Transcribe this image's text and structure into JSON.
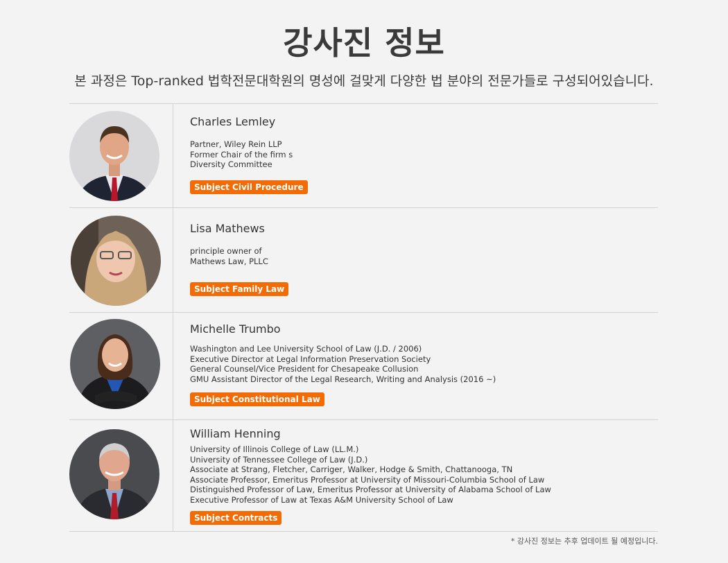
{
  "page": {
    "title": "강사진 정보",
    "subtitle": "본 과정은 Top-ranked 법학전문대학원의 명성에 걸맞게 다양한 법 분야의 전문가들로 구성되어있습니다.",
    "footnote": "* 강사진 정보는 추후 업데이트 될 예정입니다."
  },
  "accent_color": "#f26b05",
  "instructors": [
    {
      "name": "Charles Lemley",
      "lines": [
        "Partner, Wiley Rein LLP",
        "Former Chair of the firm s",
        "Diversity Committee"
      ],
      "subject": "Subject Civil Procedure"
    },
    {
      "name": "Lisa Mathews",
      "lines": [
        "principle owner of",
        "Mathews Law, PLLC"
      ],
      "subject": "Subject Family Law"
    },
    {
      "name": "Michelle Trumbo",
      "lines": [
        "Washington and Lee University School of Law (J.D. / 2006)",
        "Executive Director at Legal Information Preservation Society",
        "General Counsel/Vice President for Chesapeake Collusion",
        "GMU Assistant Director of the Legal Research, Writing and Analysis (2016 ~)"
      ],
      "subject": "Subject Constitutional Law"
    },
    {
      "name": "William Henning",
      "lines": [
        "University of Illinois College of Law (LL.M.)",
        "University of Tennessee College of Law (J.D.)",
        "Associate at Strang, Fletcher, Carriger, Walker, Hodge & Smith, Chattanooga, TN",
        "Associate Professor, Emeritus Professor at University of Missouri-Columbia School of Law",
        "Distinguished Professor of Law, Emeritus Professor at University of Alabama School of Law",
        "Executive Professor of Law at Texas A&M University School of Law"
      ],
      "subject": "Subject Contracts"
    }
  ]
}
